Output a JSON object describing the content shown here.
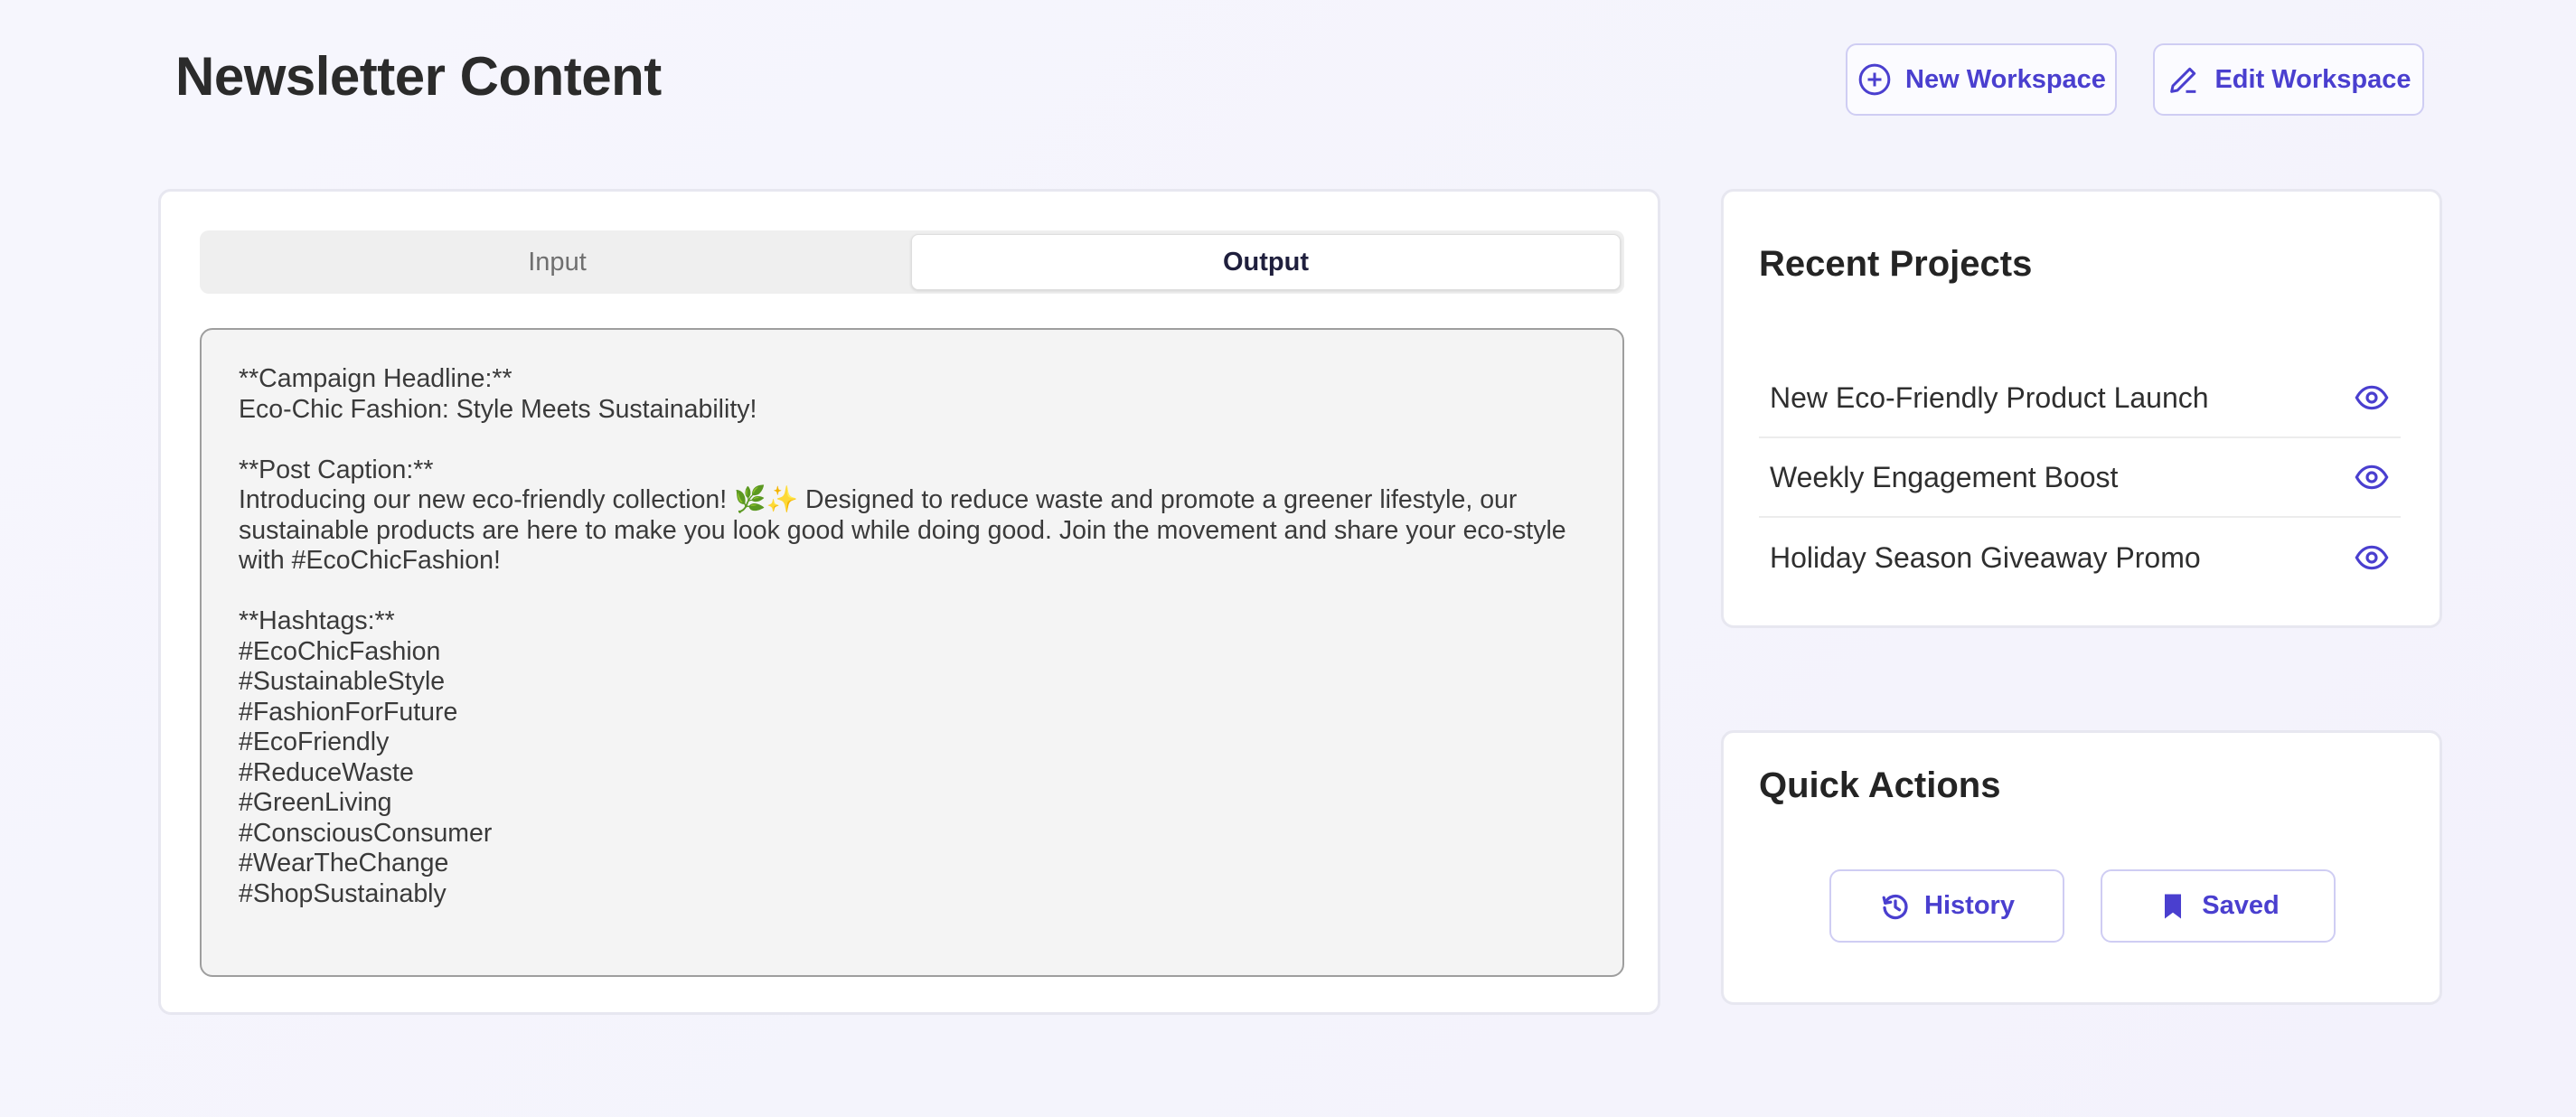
{
  "header": {
    "title": "Newsletter Content",
    "new_workspace_label": "New Workspace",
    "edit_workspace_label": "Edit Workspace"
  },
  "tabs": [
    {
      "label": "Input",
      "active": false
    },
    {
      "label": "Output",
      "active": true
    }
  ],
  "output": {
    "text": "**Campaign Headline:**\nEco-Chic Fashion: Style Meets Sustainability!\n\n**Post Caption:**\nIntroducing our new eco-friendly collection! 🌿✨ Designed to reduce waste and promote a greener lifestyle, our sustainable products are here to make you look good while doing good. Join the movement and share your eco-style with #EcoChicFashion!\n\n**Hashtags:**\n#EcoChicFashion\n#SustainableStyle\n#FashionForFuture\n#EcoFriendly\n#ReduceWaste\n#GreenLiving\n#ConsciousConsumer\n#WearTheChange\n#ShopSustainably"
  },
  "recent_projects": {
    "heading": "Recent Projects",
    "items": [
      {
        "name": "New Eco-Friendly Product Launch",
        "icon": "eye-icon"
      },
      {
        "name": "Weekly Engagement Boost",
        "icon": "eye-icon"
      },
      {
        "name": "Holiday Season Giveaway Promo",
        "icon": "eye-icon"
      }
    ]
  },
  "quick_actions": {
    "heading": "Quick Actions",
    "history_label": "History",
    "saved_label": "Saved"
  },
  "colors": {
    "accent": "#4a3fcf",
    "background": "#f5f4fd",
    "card": "#ffffff"
  }
}
